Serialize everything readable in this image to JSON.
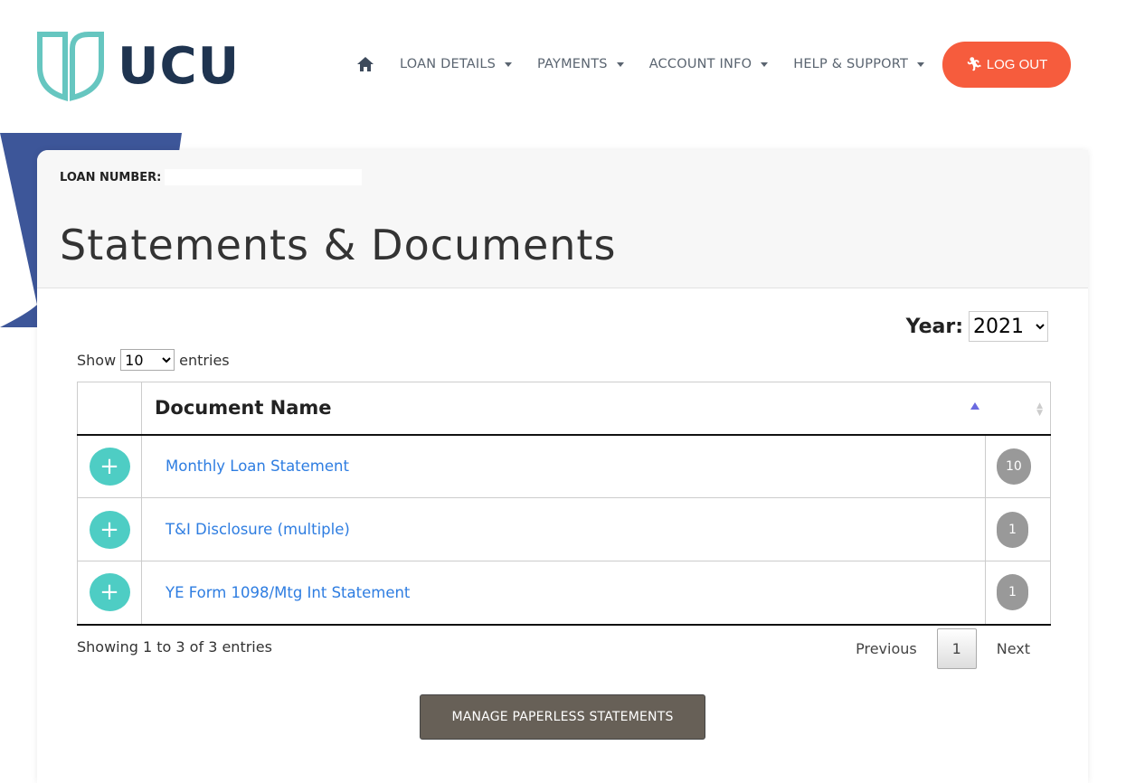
{
  "brand": {
    "name": "UCU",
    "logo_color": "#66c6c0",
    "text_color": "#1f3450"
  },
  "nav": {
    "items": [
      {
        "label": "LOAN DETAILS"
      },
      {
        "label": "PAYMENTS"
      },
      {
        "label": "ACCOUNT INFO"
      },
      {
        "label": "HELP & SUPPORT"
      }
    ],
    "logout": "LOG OUT",
    "accent": "#f65c3d"
  },
  "card": {
    "loan_label": "LOAN NUMBER:",
    "title": "Statements & Documents"
  },
  "year": {
    "label": "Year:",
    "value": "2021"
  },
  "length": {
    "show": "Show",
    "value": "10",
    "entries": "entries"
  },
  "table": {
    "header": "Document Name",
    "rows": [
      {
        "name": "Monthly Loan Statement",
        "count": "10"
      },
      {
        "name": "T&I Disclosure (multiple)",
        "count": "1"
      },
      {
        "name": "YE Form 1098/Mtg Int Statement",
        "count": "1"
      }
    ]
  },
  "info": "Showing 1 to 3 of 3 entries",
  "pager": {
    "previous": "Previous",
    "page": "1",
    "next": "Next"
  },
  "manage": "MANAGE PAPERLESS STATEMENTS"
}
